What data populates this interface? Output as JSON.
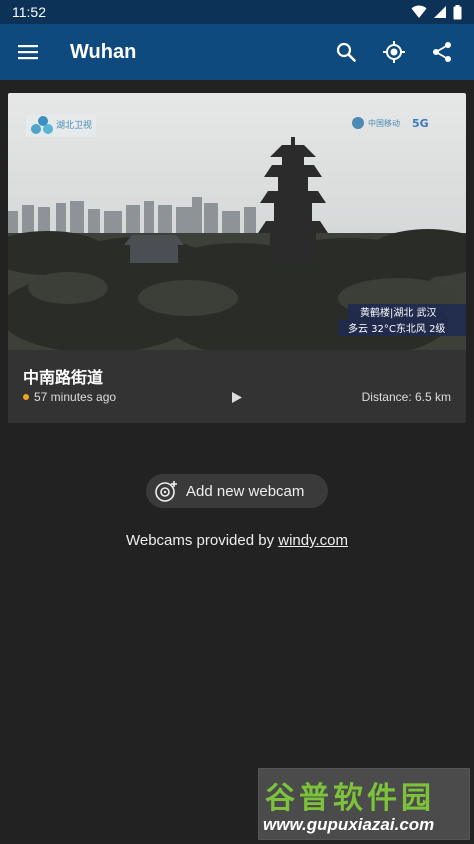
{
  "status_bar": {
    "time": "11:52"
  },
  "app_bar": {
    "title": "Wuhan"
  },
  "webcam": {
    "title": "中南路街道",
    "updated": "57 minutes ago",
    "distance": "Distance: 6.5 km",
    "overlay": {
      "logo_left": "湖北卫视",
      "logo_right": "中国移动",
      "net": "5G",
      "caption_line1": "黄鹤楼|湖北 武汉",
      "caption_line2": "多云 32°C东北风 2级"
    }
  },
  "add_webcam": {
    "label": "Add new webcam"
  },
  "footer": {
    "provided_prefix": "Webcams provided by ",
    "provided_link": "windy.com"
  },
  "watermark": {
    "title": "谷普软件园",
    "url": "www.gupuxiazai.com"
  }
}
